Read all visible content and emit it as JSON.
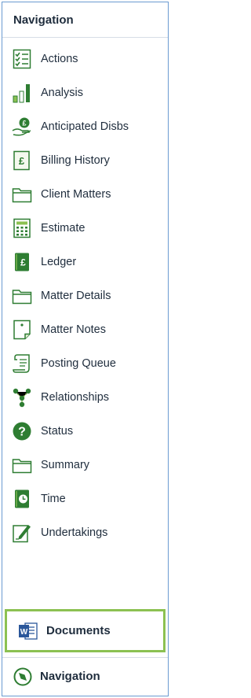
{
  "panel": {
    "title": "Navigation",
    "items": [
      {
        "label": "Actions",
        "icon": "checklist-icon"
      },
      {
        "label": "Analysis",
        "icon": "bar-chart-icon"
      },
      {
        "label": "Anticipated Disbs",
        "icon": "money-hand-icon"
      },
      {
        "label": "Billing History",
        "icon": "pound-document-icon"
      },
      {
        "label": "Client Matters",
        "icon": "folder-icon"
      },
      {
        "label": "Estimate",
        "icon": "calculator-icon"
      },
      {
        "label": "Ledger",
        "icon": "ledger-book-icon"
      },
      {
        "label": "Matter Details",
        "icon": "folder-icon"
      },
      {
        "label": "Matter Notes",
        "icon": "note-icon"
      },
      {
        "label": "Posting Queue",
        "icon": "scroll-icon"
      },
      {
        "label": "Relationships",
        "icon": "relationships-icon"
      },
      {
        "label": "Status",
        "icon": "question-icon"
      },
      {
        "label": "Summary",
        "icon": "folder-icon"
      },
      {
        "label": "Time",
        "icon": "clock-book-icon"
      },
      {
        "label": "Undertakings",
        "icon": "pen-document-icon"
      }
    ]
  },
  "bottom": {
    "documents_label": "Documents",
    "navigation_label": "Navigation"
  },
  "colors": {
    "accent_green": "#8cc152",
    "icon_dark_green": "#2e7d32",
    "border_blue": "#6b9bd1"
  }
}
